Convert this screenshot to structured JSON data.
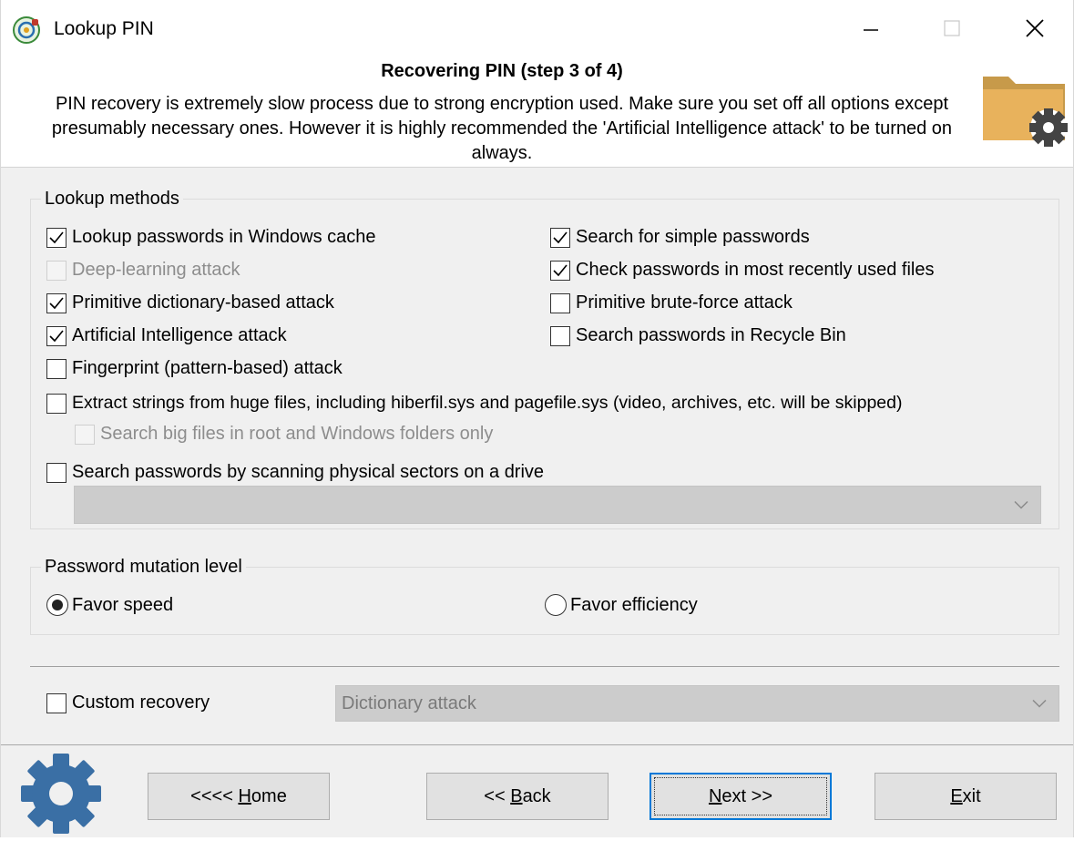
{
  "window": {
    "title": "Lookup PIN",
    "minimize_icon": "minimize-icon",
    "maximize_icon": "maximize-icon",
    "close_icon": "close-icon"
  },
  "header": {
    "title": "Recovering PIN (step 3 of 4)",
    "description": "PIN recovery is extremely slow process due to strong encryption used. Make sure you set off all options except presumably necessary ones. However it is highly recommended the 'Artificial Intelligence attack' to be turned on always.",
    "icon": "folder-gear-icon"
  },
  "lookup_methods": {
    "label": "Lookup methods",
    "options": [
      {
        "label": "Lookup passwords in Windows cache",
        "checked": true,
        "enabled": true
      },
      {
        "label": "Deep-learning attack",
        "checked": false,
        "enabled": false
      },
      {
        "label": "Primitive dictionary-based attack",
        "checked": true,
        "enabled": true
      },
      {
        "label": "Artificial Intelligence attack",
        "checked": true,
        "enabled": true
      },
      {
        "label": "Fingerprint (pattern-based) attack",
        "checked": false,
        "enabled": true
      },
      {
        "label": "Search for simple passwords",
        "checked": true,
        "enabled": true
      },
      {
        "label": "Check passwords in most recently used files",
        "checked": true,
        "enabled": true
      },
      {
        "label": "Primitive brute-force attack",
        "checked": false,
        "enabled": true
      },
      {
        "label": "Search passwords in Recycle Bin",
        "checked": false,
        "enabled": true
      },
      {
        "label": "Extract strings from huge files, including hiberfil.sys and pagefile.sys (video, archives, etc. will be skipped)",
        "checked": false,
        "enabled": true
      },
      {
        "label": "Search big files in root and Windows folders only",
        "checked": false,
        "enabled": false
      },
      {
        "label": "Search passwords by scanning physical sectors on a drive",
        "checked": false,
        "enabled": true
      }
    ],
    "drive_select_value": ""
  },
  "mutation": {
    "label": "Password mutation level",
    "options": [
      {
        "label": "Favor speed",
        "selected": true
      },
      {
        "label": "Favor efficiency",
        "selected": false
      }
    ]
  },
  "custom_recovery": {
    "label": "Custom recovery",
    "checked": false,
    "select_value": "Dictionary attack"
  },
  "footer": {
    "logo_icon": "gear-icon",
    "home": {
      "prefix": "<<<< ",
      "accel": "H",
      "rest": "ome"
    },
    "back": {
      "prefix": "<< ",
      "accel": "B",
      "rest": "ack"
    },
    "next": {
      "prefix": "",
      "accel": "N",
      "rest": "ext >>"
    },
    "exit": {
      "prefix": "",
      "accel": "E",
      "rest": "xit"
    }
  }
}
